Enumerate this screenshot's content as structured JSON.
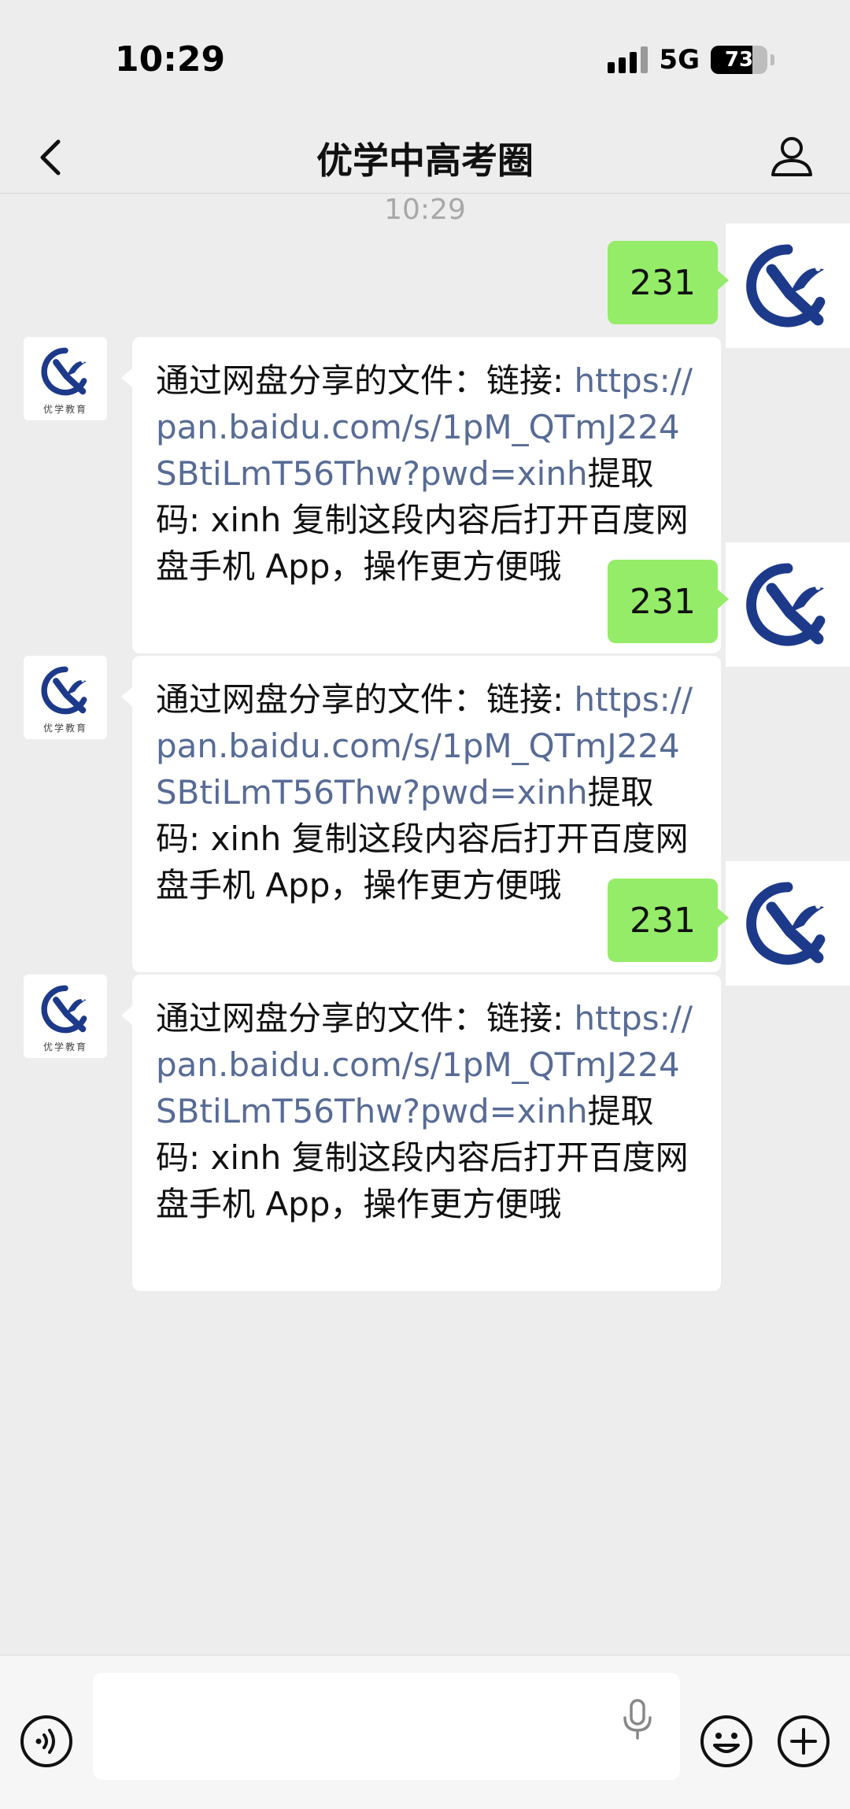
{
  "status_bar": {
    "time": "10:29",
    "network": "5G",
    "battery": "73",
    "battery_level": 0.73
  },
  "nav": {
    "title": "优学中高考圈"
  },
  "chat": {
    "time_label": "10:29",
    "messages": [
      {
        "sent_text": "231",
        "recv_prefix": "通过网盘分享的文件：链接: ",
        "recv_link": "https://pan.baidu.com/s/1pM_QTmJ224SBtiLmT56Thw?pwd=xinh",
        "recv_suffix": "提取码: xinh 复制这段内容后打开百度网盘手机 App，操作更方便哦"
      },
      {
        "sent_text": "231",
        "recv_prefix": "通过网盘分享的文件：链接: ",
        "recv_link": "https://pan.baidu.com/s/1pM_QTmJ224SBtiLmT56Thw?pwd=xinh",
        "recv_suffix": "提取码: xinh 复制这段内容后打开百度网盘手机 App，操作更方便哦"
      },
      {
        "sent_text": "231",
        "recv_prefix": "通过网盘分享的文件：链接: ",
        "recv_link": "https://pan.baidu.com/s/1pM_QTmJ224SBtiLmT56Thw?pwd=xinh",
        "recv_suffix": "提取码: xinh 复制这段内容后打开百度网盘手机 App，操作更方便哦"
      }
    ],
    "peer_avatar_caption": "优学教育"
  },
  "colors": {
    "sent_bubble": "#95ec69",
    "link": "#576b95",
    "logo_blue": "#1d3a8a"
  },
  "icons": {
    "back": "chevron-left-icon",
    "profile": "person-icon",
    "voice": "voice-icon",
    "mic": "microphone-icon",
    "emoji": "emoji-icon",
    "plus": "plus-icon"
  }
}
